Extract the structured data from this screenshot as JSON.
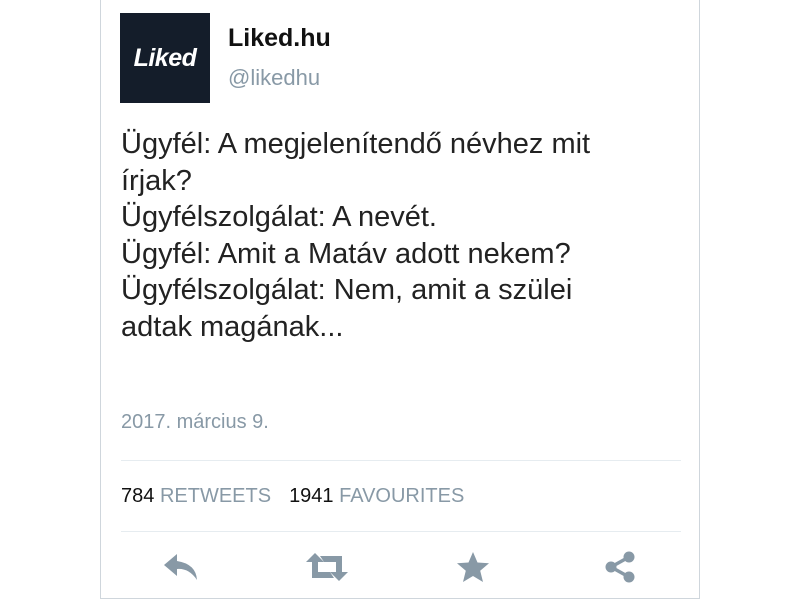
{
  "account": {
    "avatar_text": "Liked",
    "display_name": "Liked.hu",
    "handle": "@likedhu"
  },
  "tweet": {
    "lines": [
      "Ügyfél: A megjelenítendő névhez mit",
      "írjak?",
      "Ügyfélszolgálat: A nevét.",
      "Ügyfél: Amit a Matáv adott nekem?",
      "Ügyfélszolgálat: Nem, amit a szülei",
      "adtak magának..."
    ],
    "timestamp": "2017. március 9."
  },
  "stats": {
    "retweets_count": "784",
    "retweets_label": "RETWEETS",
    "favourites_count": "1941",
    "favourites_label": "FAVOURITES"
  },
  "actions": {
    "icons": [
      "reply-icon",
      "retweet-icon",
      "favourite-star-icon",
      "share-icon"
    ]
  },
  "colors": {
    "avatar_bg": "#141d2a",
    "muted_text": "#8899a6",
    "icon": "#8899a6",
    "body_text": "#222222"
  }
}
